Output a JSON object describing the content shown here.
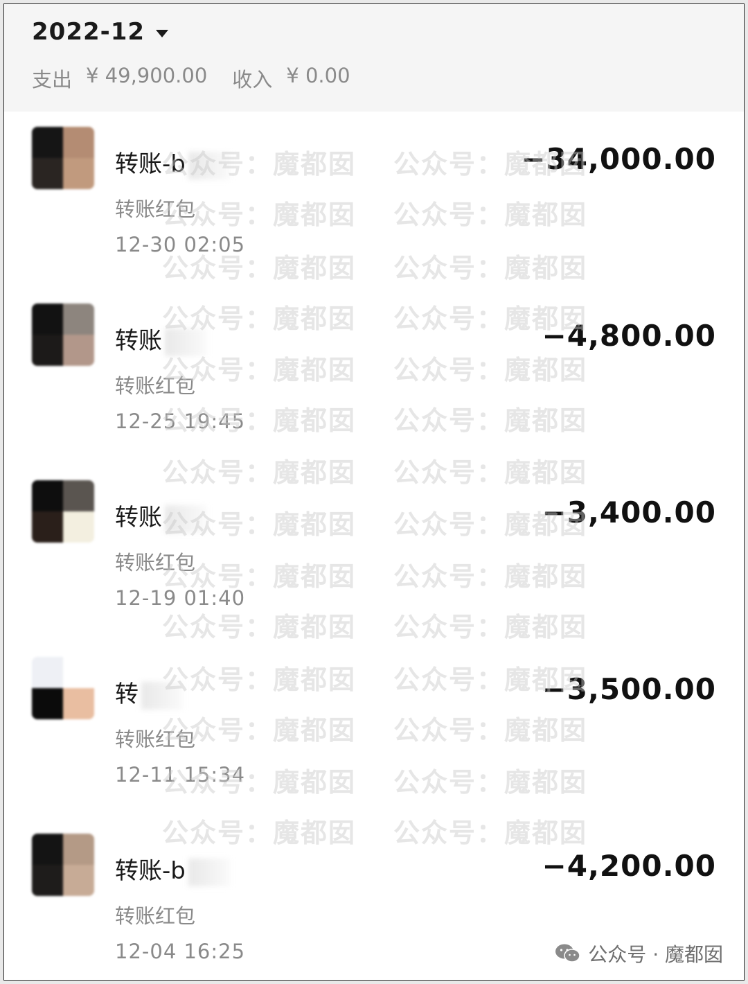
{
  "header": {
    "month": "2022-12",
    "expense_label": "支出",
    "expense_value": "¥ 49,900.00",
    "income_label": "收入",
    "income_value": "¥ 0.00"
  },
  "transactions": [
    {
      "name": "转账-b",
      "type": "转账红包",
      "time": "12-30  02:05",
      "amount": "−34,000.00"
    },
    {
      "name": "转账",
      "type": "转账红包",
      "time": "12-25  19:45",
      "amount": "−4,800.00"
    },
    {
      "name": "转账",
      "type": "转账红包",
      "time": "12-19  01:40",
      "amount": "−3,400.00"
    },
    {
      "name": "转",
      "type": "转账红包",
      "time": "12-11  15:34",
      "amount": "−3,500.00"
    },
    {
      "name": "转账-b",
      "type": "转账红包",
      "time": "12-04  16:25",
      "amount": "−4,200.00"
    }
  ],
  "watermark": {
    "text": "公众号：魔都囡"
  },
  "footer": {
    "text": "公众号 · 魔都囡",
    "icon": "wechat-icon"
  }
}
